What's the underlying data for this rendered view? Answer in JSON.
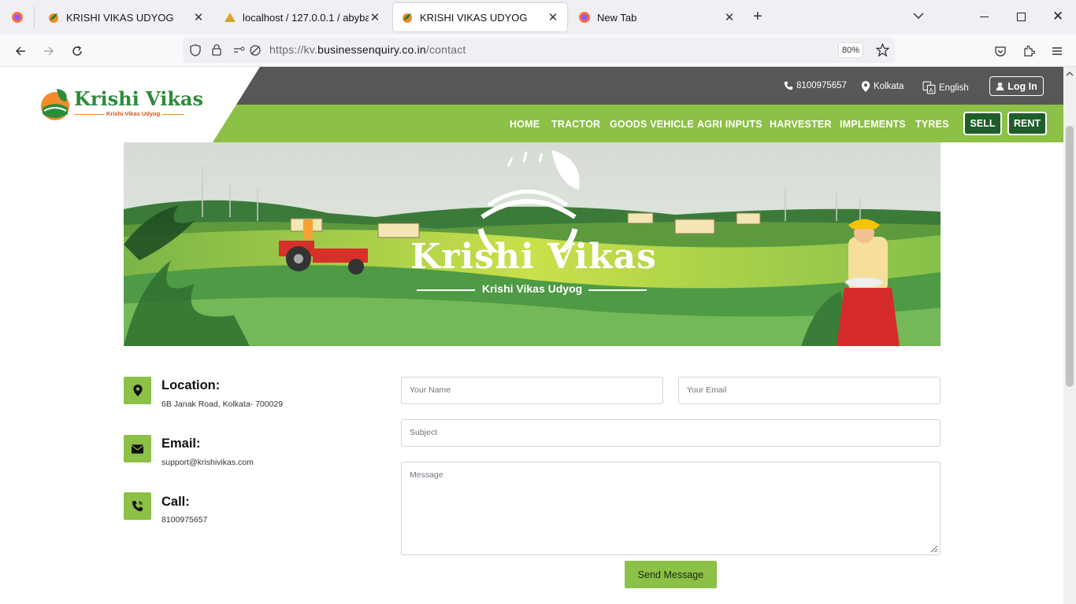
{
  "browser": {
    "tabs": [
      {
        "title": "KRISHI VIKAS UDYOG",
        "active": false
      },
      {
        "title": "localhost / 127.0.0.1 / abybabye",
        "active": false
      },
      {
        "title": "KRISHI VIKAS UDYOG",
        "active": true
      },
      {
        "title": "New Tab",
        "active": false
      }
    ],
    "url_prefix": "https://kv.",
    "url_domain": "businessenquiry.co.in",
    "url_path": "/contact",
    "zoom": "80%"
  },
  "site": {
    "logo_title": "Krishi Vikas",
    "logo_subtitle": "Krishi Vikas Udyog",
    "phone": "8100975657",
    "location": "Kolkata",
    "language": "English",
    "login_label": "Log In",
    "menu": [
      "HOME",
      "TRACTOR",
      "GOODS VEHICLE",
      "AGRI INPUTS",
      "HARVESTER",
      "IMPLEMENTS",
      "TYRES"
    ],
    "sell_label": "SELL",
    "rent_label": "RENT"
  },
  "banner": {
    "title": "Krishi Vikas",
    "subtitle": "Krishi Vikas Udyog"
  },
  "contact": {
    "location_label": "Location:",
    "location_value": "6B Janak Road, Kolkata- 700029",
    "email_label": "Email:",
    "email_value": "support@krishivikas.com",
    "call_label": "Call:",
    "call_value": "8100975657"
  },
  "form": {
    "name_placeholder": "Your Name",
    "email_placeholder": "Your Email",
    "subject_placeholder": "Subject",
    "message_placeholder": "Message",
    "send_label": "Send Message"
  },
  "colors": {
    "brand_green": "#8cc046",
    "dark_green": "#1f5d2a",
    "header_dark": "#575757"
  }
}
